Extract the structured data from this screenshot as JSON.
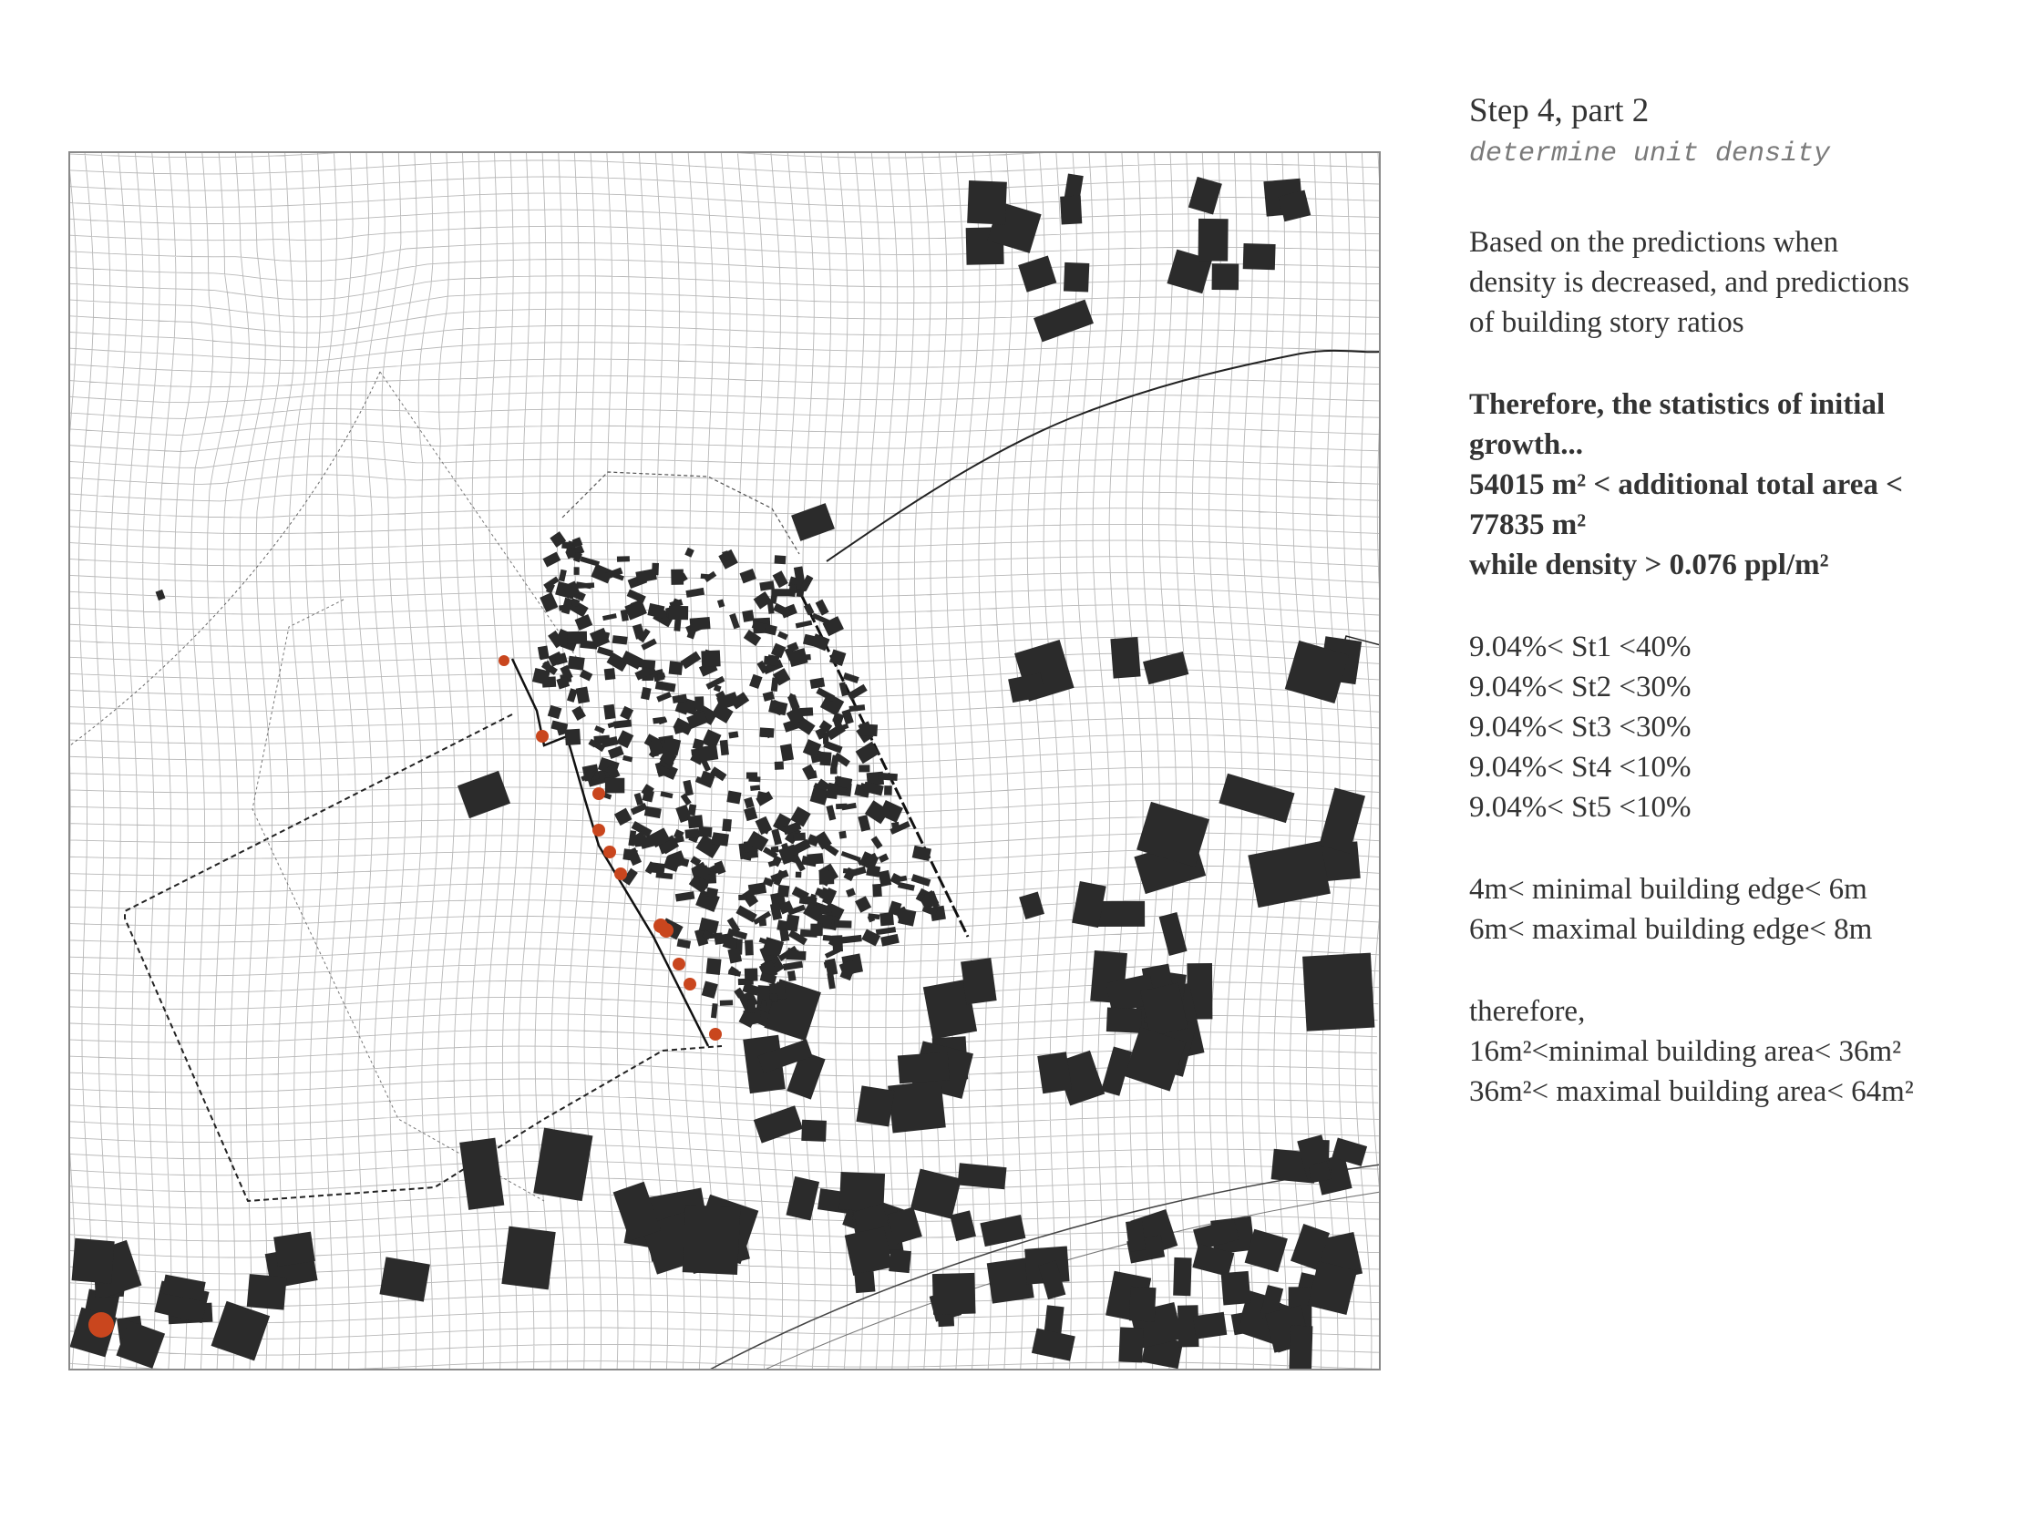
{
  "header": {
    "title": "Step 4, part 2",
    "subtitle": "determine unit density"
  },
  "intro": {
    "lines": [
      "Based on the predictions when",
      "density is decreased, and predictions",
      "of building story ratios"
    ]
  },
  "conclusion": {
    "lines": [
      "Therefore, the statistics of initial",
      "growth...",
      "54015 m² < additional total area <",
      "77835 m²",
      "while density > 0.076 ppl/m²"
    ]
  },
  "story_ratios": [
    "9.04%< St1 <40%",
    "9.04%< St2 <30%",
    "9.04%< St3 <30%",
    "9.04%< St4 <10%",
    "9.04%< St5 <10%"
  ],
  "edges": [
    "4m< minimal building edge< 6m",
    "6m< maximal building edge< 8m"
  ],
  "areas": [
    "therefore,",
    "16m²<minimal building area< 36m²",
    "36m²< maximal building area< 64m²"
  ],
  "colors": {
    "building_fill": "#2b2b2b",
    "grid_line": "#b8b8b8",
    "entry_point": "#c9461e",
    "boundary": "#333333"
  }
}
